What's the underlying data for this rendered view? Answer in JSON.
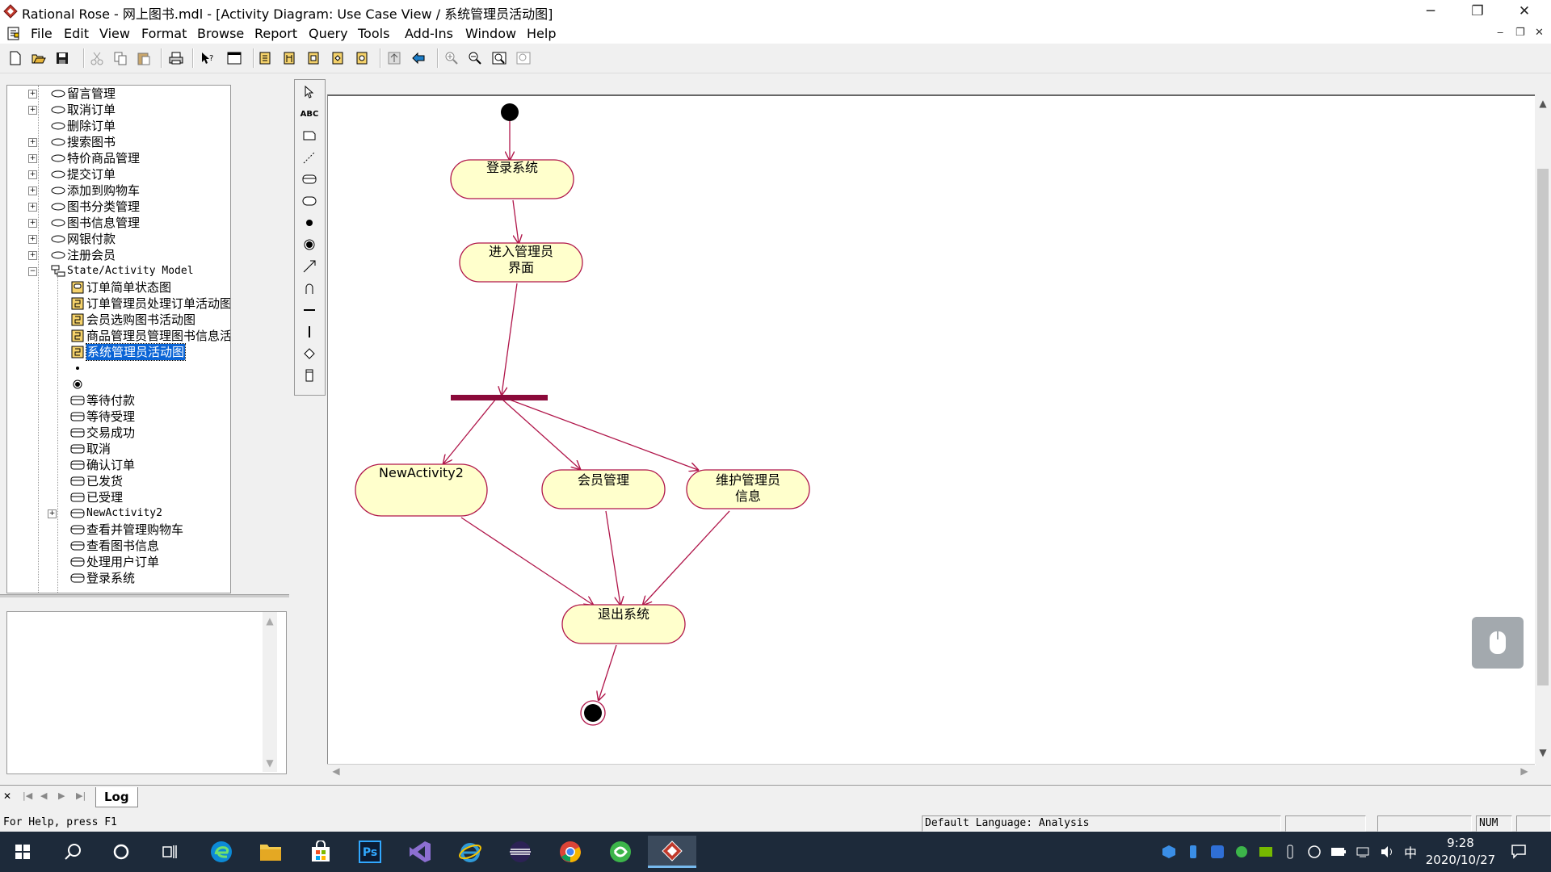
{
  "window": {
    "title": "Rational Rose - 网上图书.mdl - [Activity Diagram: Use Case View / 系统管理员活动图]",
    "controls": {
      "minimize": "─",
      "maximize": "❐",
      "close": "✕"
    }
  },
  "menubar": {
    "items": [
      "File",
      "Edit",
      "View",
      "Format",
      "Browse",
      "Report",
      "Query",
      "Tools",
      "Add-Ins",
      "Window",
      "Help"
    ],
    "mdi_controls": {
      "minimize": "‒",
      "restore": "❐",
      "close": "✕"
    }
  },
  "toolbar": {
    "icons": [
      "new-icon",
      "open-icon",
      "save-icon",
      "cut-icon",
      "copy-icon",
      "paste-icon",
      "print-icon",
      "context-help-icon",
      "view-doc-icon",
      "browse-class-diagram-icon",
      "browse-interaction-diagram-icon",
      "browse-component-diagram-icon",
      "browse-deployment-diagram-icon",
      "browse-parent-icon",
      "browse-previous-icon",
      "zoom-in-icon",
      "zoom-out-icon",
      "fit-in-window-icon",
      "undo-fit-icon"
    ]
  },
  "browser": {
    "tree": [
      {
        "label": "留言管理",
        "kind": "usecase",
        "expandable": true,
        "level": 1
      },
      {
        "label": "取消订单",
        "kind": "usecase",
        "expandable": true,
        "level": 1
      },
      {
        "label": "删除订单",
        "kind": "usecase",
        "expandable": false,
        "level": 1
      },
      {
        "label": "搜索图书",
        "kind": "usecase",
        "expandable": true,
        "level": 1
      },
      {
        "label": "特价商品管理",
        "kind": "usecase",
        "expandable": true,
        "level": 1
      },
      {
        "label": "提交订单",
        "kind": "usecase",
        "expandable": true,
        "level": 1
      },
      {
        "label": "添加到购物车",
        "kind": "usecase",
        "expandable": true,
        "level": 1
      },
      {
        "label": "图书分类管理",
        "kind": "usecase",
        "expandable": true,
        "level": 1
      },
      {
        "label": "图书信息管理",
        "kind": "usecase",
        "expandable": true,
        "level": 1
      },
      {
        "label": "网银付款",
        "kind": "usecase",
        "expandable": true,
        "level": 1
      },
      {
        "label": "注册会员",
        "kind": "usecase",
        "expandable": true,
        "level": 1
      },
      {
        "label": "State/Activity Model",
        "kind": "model",
        "expandable": true,
        "expanded": true,
        "level": 1
      },
      {
        "label": "订单简单状态图",
        "kind": "statechart",
        "level": 2
      },
      {
        "label": "订单管理员处理订单活动图",
        "kind": "activity-diagram",
        "level": 2
      },
      {
        "label": "会员选购图书活动图",
        "kind": "activity-diagram",
        "level": 2
      },
      {
        "label": "商品管理员管理图书信息活动图",
        "kind": "activity-diagram",
        "level": 2
      },
      {
        "label": "系统管理员活动图",
        "kind": "activity-diagram",
        "level": 2,
        "selected": true
      },
      {
        "label": "",
        "kind": "initial",
        "level": 2
      },
      {
        "label": "",
        "kind": "final",
        "level": 2
      },
      {
        "label": "等待付款",
        "kind": "state",
        "level": 2
      },
      {
        "label": "等待受理",
        "kind": "state",
        "level": 2
      },
      {
        "label": "交易成功",
        "kind": "state",
        "level": 2
      },
      {
        "label": "取消",
        "kind": "state",
        "level": 2
      },
      {
        "label": "确认订单",
        "kind": "state",
        "level": 2
      },
      {
        "label": "已发货",
        "kind": "state",
        "level": 2
      },
      {
        "label": "已受理",
        "kind": "state",
        "level": 2
      },
      {
        "label": "NewActivity2",
        "kind": "activity",
        "level": 2,
        "expandable": true
      },
      {
        "label": "查看并管理购物车",
        "kind": "activity",
        "level": 2
      },
      {
        "label": "查看图书信息",
        "kind": "activity",
        "level": 2
      },
      {
        "label": "处理用户订单",
        "kind": "activity",
        "level": 2
      },
      {
        "label": "登录系统",
        "kind": "activity",
        "level": 2
      }
    ]
  },
  "palette": {
    "tools": [
      "selection-arrow-icon",
      "text-box-icon",
      "note-icon",
      "anchor-note-icon",
      "state-icon",
      "activity-icon",
      "start-state-icon",
      "end-state-icon",
      "state-transition-icon",
      "transition-to-self-icon",
      "horizontal-sync-icon",
      "vertical-sync-icon",
      "decision-icon",
      "swimlane-icon"
    ],
    "text_tool_label": "ABC"
  },
  "diagram": {
    "activities": [
      {
        "id": "login",
        "label": "登录系统"
      },
      {
        "id": "enter_admin",
        "label": "进入管理员\n界面"
      },
      {
        "id": "new_activity",
        "label": "NewActivity2"
      },
      {
        "id": "member_mgmt",
        "label": "会员管理"
      },
      {
        "id": "maintain_admin",
        "label": "维护管理员\n信息"
      },
      {
        "id": "logout",
        "label": "退出系统"
      }
    ],
    "colors": {
      "activity_fill": "#ffffcc",
      "line": "#b0164a",
      "sync_bar": "#8b0a3a"
    }
  },
  "log": {
    "tab_label": "Log"
  },
  "statusbar": {
    "help": "For Help, press F1",
    "language": "Default Language: Analysis",
    "num": "NUM"
  },
  "taskbar": {
    "apps": [
      "windows-start-icon",
      "search-icon",
      "cortana-icon",
      "task-view-icon",
      "edge-icon",
      "file-explorer-icon",
      "store-icon",
      "photoshop-icon",
      "visual-studio-icon",
      "ie-icon",
      "eclipse-icon",
      "chrome-icon",
      "360-browser-icon",
      "rational-rose-icon"
    ],
    "photoshop_label": "Ps",
    "ime": "中",
    "time": "9:28",
    "date": "2020/10/27"
  }
}
